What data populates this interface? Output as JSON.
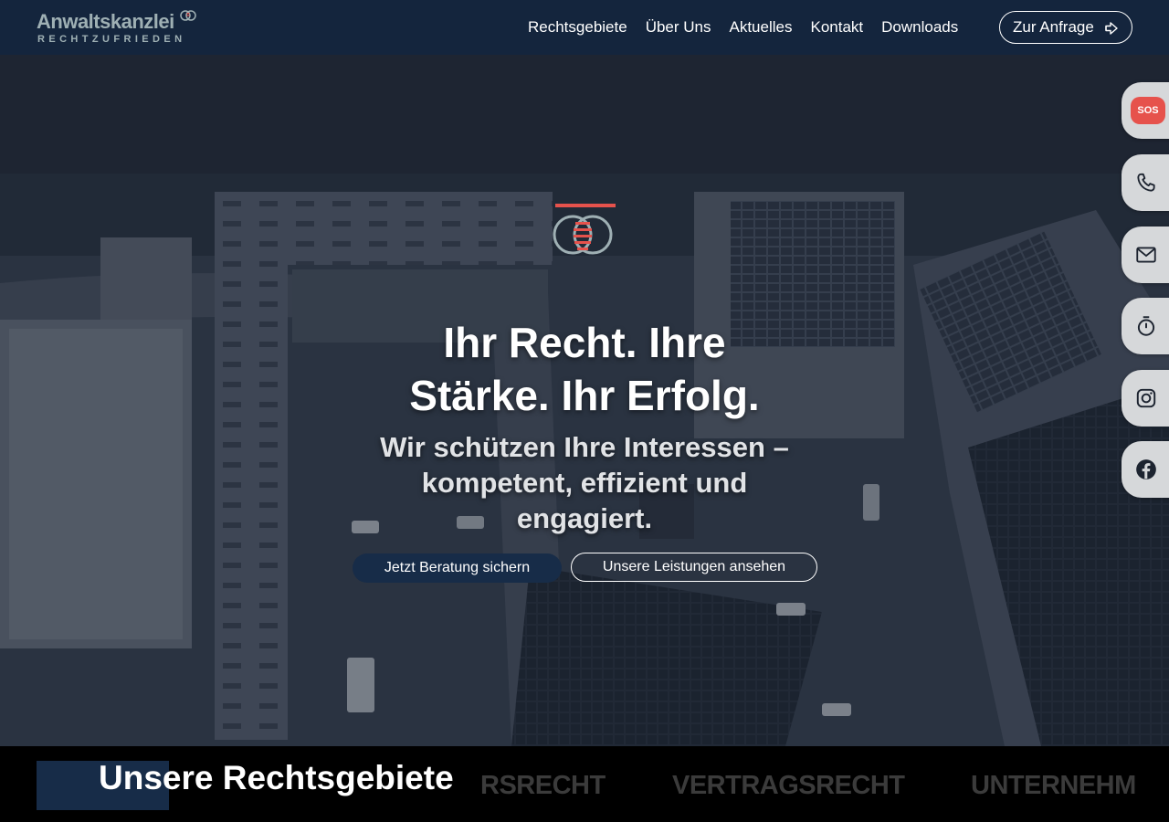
{
  "header": {
    "logo_main": "Anwaltskanzlei",
    "logo_sub": "RECHTZUFRIEDEN",
    "nav": [
      "Rechtsgebiete",
      "Über Uns",
      "Aktuelles",
      "Kontakt",
      "Downloads"
    ],
    "cta_label": "Zur Anfrage",
    "cta_icon": "arrow-right-icon"
  },
  "hero": {
    "title_line1": "Ihr Recht. Ihre",
    "title_line2": "Stärke. Ihr Erfolg.",
    "subtitle_line1": "Wir schützen Ihre Interessen –",
    "subtitle_line2": "kompetent, effizient und",
    "subtitle_line3": "engagiert.",
    "primary_button": "Jetzt Beratung sichern",
    "secondary_button": "Unsere Leistungen ansehen"
  },
  "dock": {
    "sos_label": "SOS",
    "icons": [
      "sos-icon",
      "phone-icon",
      "mail-icon",
      "stopwatch-icon",
      "instagram-icon",
      "facebook-icon"
    ]
  },
  "ticker": {
    "title": "Unsere Rechtsgebiete",
    "words": [
      "RSRECHT",
      "VERTRAGSRECHT",
      "UNTERNEHM"
    ]
  },
  "colors": {
    "header_bg": "#14253d",
    "primary": "#172c48",
    "sos": "#e6524c",
    "logo": "#9fb0b4",
    "dock_bg": "#d6d8da"
  }
}
